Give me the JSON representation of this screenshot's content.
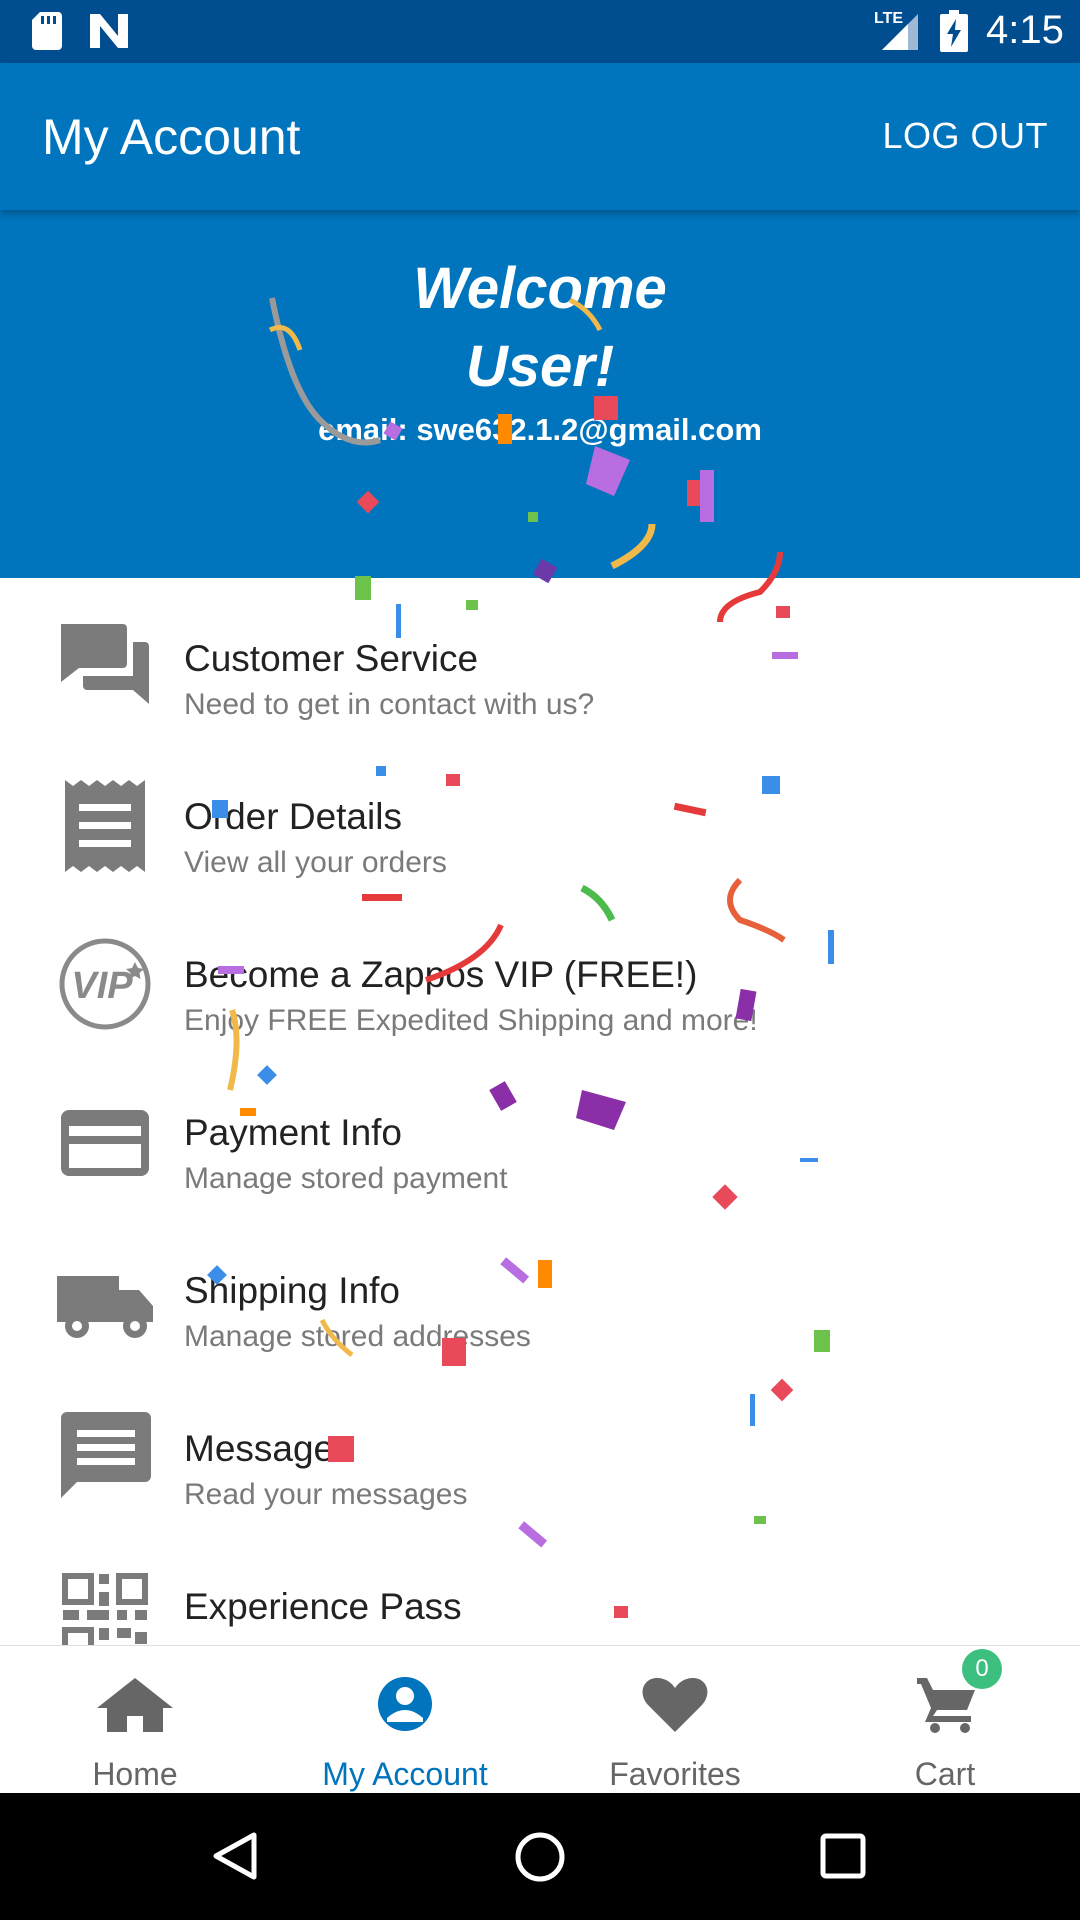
{
  "status_bar": {
    "network": "LTE",
    "time": "4:15"
  },
  "app_bar": {
    "title": "My Account",
    "logout_label": "LOG OUT"
  },
  "welcome": {
    "line1": "Welcome",
    "line2": "User!",
    "email": "email: swe632.1.2@gmail.com"
  },
  "menu": [
    {
      "label": "Customer Service",
      "sub": "Need to get in contact with us?",
      "icon": "chat-icon"
    },
    {
      "label": "Order Details",
      "sub": "View all your orders",
      "icon": "receipt-icon"
    },
    {
      "label": "Become a Zappos VIP (FREE!)",
      "sub": "Enjoy FREE Expedited Shipping and more!",
      "icon": "vip-icon"
    },
    {
      "label": "Payment Info",
      "sub": "Manage stored payment",
      "icon": "credit-card-icon"
    },
    {
      "label": "Shipping Info",
      "sub": "Manage stored addresses",
      "icon": "truck-icon"
    },
    {
      "label": "Messages",
      "sub": "Read your messages",
      "icon": "message-icon"
    },
    {
      "label": "Experience Pass",
      "sub": "",
      "icon": "qr-code-icon"
    }
  ],
  "bottom_nav": {
    "items": [
      {
        "label": "Home",
        "icon": "home-icon"
      },
      {
        "label": "My Account",
        "icon": "account-icon",
        "active": true
      },
      {
        "label": "Favorites",
        "icon": "heart-icon"
      },
      {
        "label": "Cart",
        "icon": "cart-icon"
      }
    ],
    "cart_count": "0"
  },
  "colors": {
    "primary": "#0074bd",
    "status_bar": "#004d8f",
    "badge": "#3dbf7f",
    "icon_gray": "#7b7b7b"
  }
}
